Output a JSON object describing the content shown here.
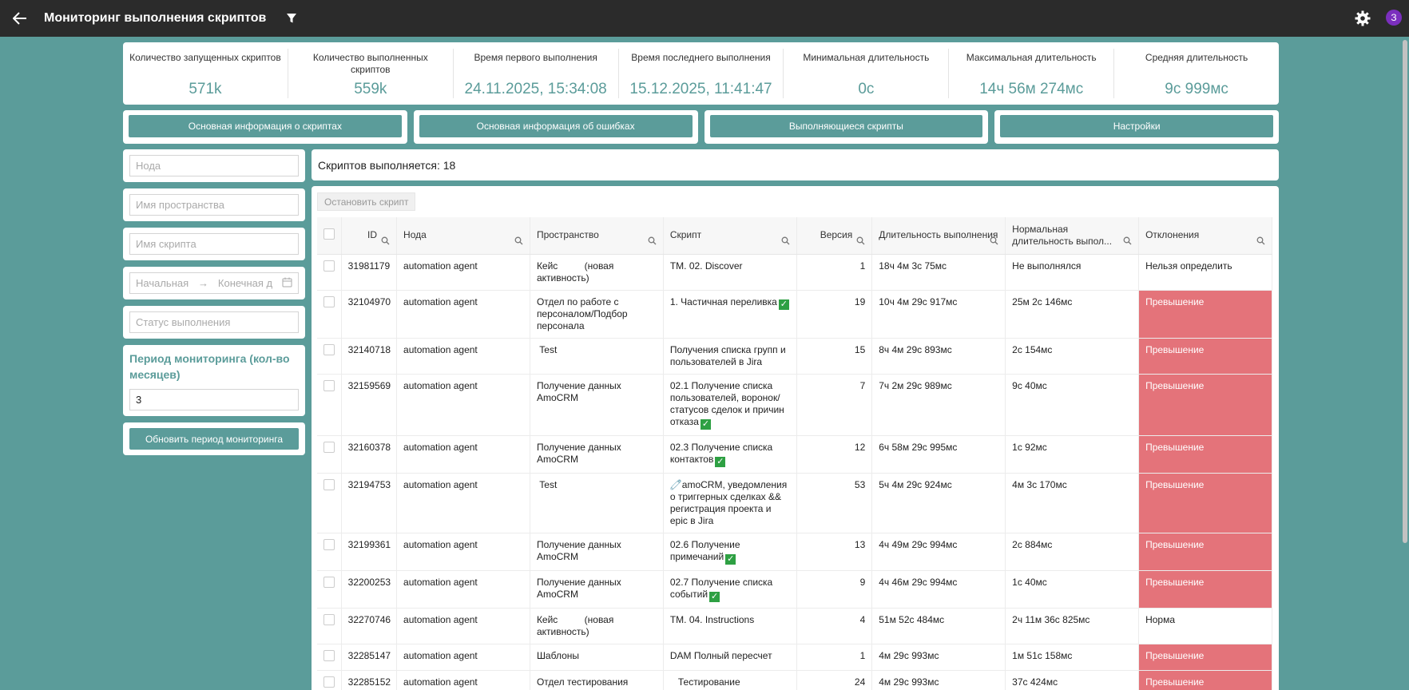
{
  "header": {
    "title": "Мониторинг выполнения скриптов",
    "avatar": "З"
  },
  "stats": [
    {
      "label": "Количество запущенных скриптов",
      "value": "571k"
    },
    {
      "label": "Количество выполненных скриптов",
      "value": "559k"
    },
    {
      "label": "Время первого выполнения",
      "value": "24.11.2025, 15:34:08"
    },
    {
      "label": "Время последнего выполнения",
      "value": "15.12.2025, 11:41:47"
    },
    {
      "label": "Минимальная длительность",
      "value": "0с"
    },
    {
      "label": "Максимальная длительность",
      "value": "14ч 56м 274мс"
    },
    {
      "label": "Средняя длительность",
      "value": "9с 999мс"
    }
  ],
  "tabs": [
    "Основная информация о скриптах",
    "Основная информация об ошибках",
    "Выполняющиеся скрипты",
    "Настройки"
  ],
  "filters": {
    "node": "Нода",
    "space": "Имя пространства",
    "script": "Имя скрипта",
    "date_start": "Начальная",
    "date_arrow": "→",
    "date_end": "Конечная д",
    "status": "Статус выполнения",
    "period_title": "Период мониторинга (кол-во месяцев)",
    "period_value": "3",
    "update_button": "Обновить период мониторинга"
  },
  "running": {
    "text": "Скриптов выполняется: 18",
    "stop_button": "Остановить скрипт"
  },
  "table": {
    "columns": [
      "ID",
      "Нода",
      "Пространство",
      "Скрипт",
      "Версия",
      "Длительность выполнения",
      "Нормальная длительность выпол...",
      "Отклонения"
    ],
    "rows": [
      {
        "id": "31981179",
        "node": "automation agent",
        "space": "Кейс          (новая активность)",
        "script": "TM. 02. Discover",
        "check": false,
        "version": "1",
        "duration": "18ч 4м 3с 75мс",
        "normal": "Не выполнялся",
        "deviation": "Нельзя определить",
        "exceed": false
      },
      {
        "id": "32104970",
        "node": "automation agent",
        "space": "Отдел по работе с персоналом/Подбор персонала",
        "script": "1. Частичная переливка",
        "check": true,
        "version": "19",
        "duration": "10ч 4м 29с 917мс",
        "normal": "25м 2с 146мс",
        "deviation": "Превышение",
        "exceed": true
      },
      {
        "id": "32140718",
        "node": "automation agent",
        "space": " Test",
        "script": "Получения списка групп и пользователей в Jira",
        "check": false,
        "version": "15",
        "duration": "8ч 4м 29с 893мс",
        "normal": "2с 154мс",
        "deviation": "Превышение",
        "exceed": true
      },
      {
        "id": "32159569",
        "node": "automation agent",
        "space": "Получение данных AmoCRM",
        "script": "02.1 Получение списка пользователей, воронок/статусов сделок и причин отказа",
        "check": true,
        "version": "7",
        "duration": "7ч 2м 29с 989мс",
        "normal": "9с 40мс",
        "deviation": "Превышение",
        "exceed": true
      },
      {
        "id": "32160378",
        "node": "automation agent",
        "space": "Получение данных AmoCRM",
        "script": "02.3 Получение списка контактов",
        "check": true,
        "version": "12",
        "duration": "6ч 58м 29с 995мс",
        "normal": "1с 92мс",
        "deviation": "Превышение",
        "exceed": true
      },
      {
        "id": "32194753",
        "node": "automation agent",
        "space": " Test",
        "script": "🧷amoCRM, уведомления о триггерных сделках && регистрация проекта и epic в Jira",
        "check": false,
        "version": "53",
        "duration": "5ч 4м 29с 924мс",
        "normal": "4м 3с 170мс",
        "deviation": "Превышение",
        "exceed": true
      },
      {
        "id": "32199361",
        "node": "automation agent",
        "space": "Получение данных AmoCRM",
        "script": "02.6 Получение примечаний",
        "check": true,
        "version": "13",
        "duration": "4ч 49м 29с 994мс",
        "normal": "2с 884мс",
        "deviation": "Превышение",
        "exceed": true
      },
      {
        "id": "32200253",
        "node": "automation agent",
        "space": "Получение данных AmoCRM",
        "script": "02.7 Получение списка событий",
        "check": true,
        "version": "9",
        "duration": "4ч 46м 29с 994мс",
        "normal": "1с 40мс",
        "deviation": "Превышение",
        "exceed": true
      },
      {
        "id": "32270746",
        "node": "automation agent",
        "space": "Кейс          (новая активность)",
        "script": "TM. 04. Instructions",
        "check": false,
        "version": "4",
        "duration": "51м 52с 484мс",
        "normal": "2ч 11м 36с 825мс",
        "deviation": "Норма",
        "exceed": false
      },
      {
        "id": "32285147",
        "node": "automation agent",
        "space": "Шаблоны",
        "script": "DAM Полный пересчет",
        "check": false,
        "version": "1",
        "duration": "4м 29с 993мс",
        "normal": "1м 51с 158мс",
        "deviation": "Превышение",
        "exceed": true
      },
      {
        "id": "32285152",
        "node": "automation agent",
        "space": "Отдел тестирования",
        "script": "   Тестирование Статистика по регрессу",
        "check": false,
        "version": "24",
        "duration": "4м 29с 993мс",
        "normal": "37с 424мс",
        "deviation": "Превышение",
        "exceed": true
      }
    ]
  },
  "colors": {
    "accent": "#5b9c9a",
    "header": "#2b2b2b",
    "exceed": "#e4737a",
    "avatar": "#7b2fbe",
    "check": "#2ea043"
  },
  "icons": [
    "back-arrow-icon",
    "filter-icon",
    "gear-icon",
    "calendar-icon",
    "search-icon",
    "checkmark-icon"
  ]
}
